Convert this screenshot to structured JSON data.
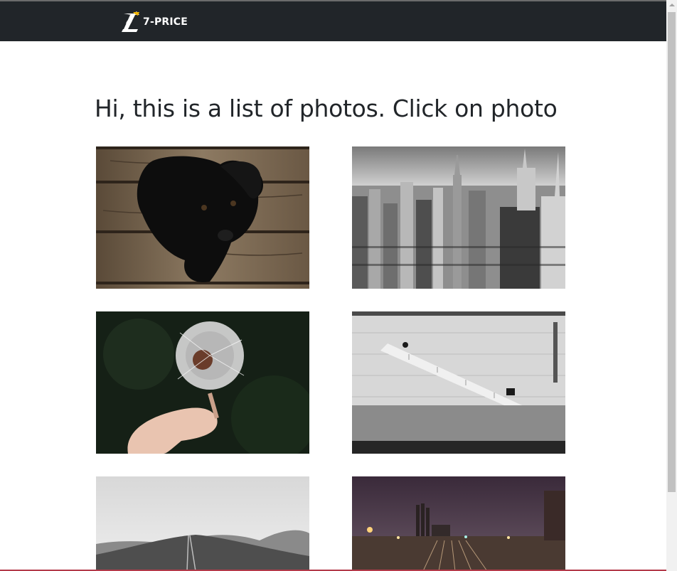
{
  "navbar": {
    "brand": "7-PRICE",
    "logo_icon": "7-price-logo-icon",
    "background": "#212529",
    "accent": "#f0b400"
  },
  "main": {
    "heading": "Hi, this is a list of photos. Click on photo",
    "photos": [
      {
        "subject": "black-puppy-on-wooden-floor"
      },
      {
        "subject": "city-skyline-black-and-white"
      },
      {
        "subject": "hand-holding-dandelion"
      },
      {
        "subject": "stairs-on-stone-wall"
      },
      {
        "subject": "grey-hills-landscape"
      },
      {
        "subject": "railway-yard-at-night"
      }
    ]
  }
}
